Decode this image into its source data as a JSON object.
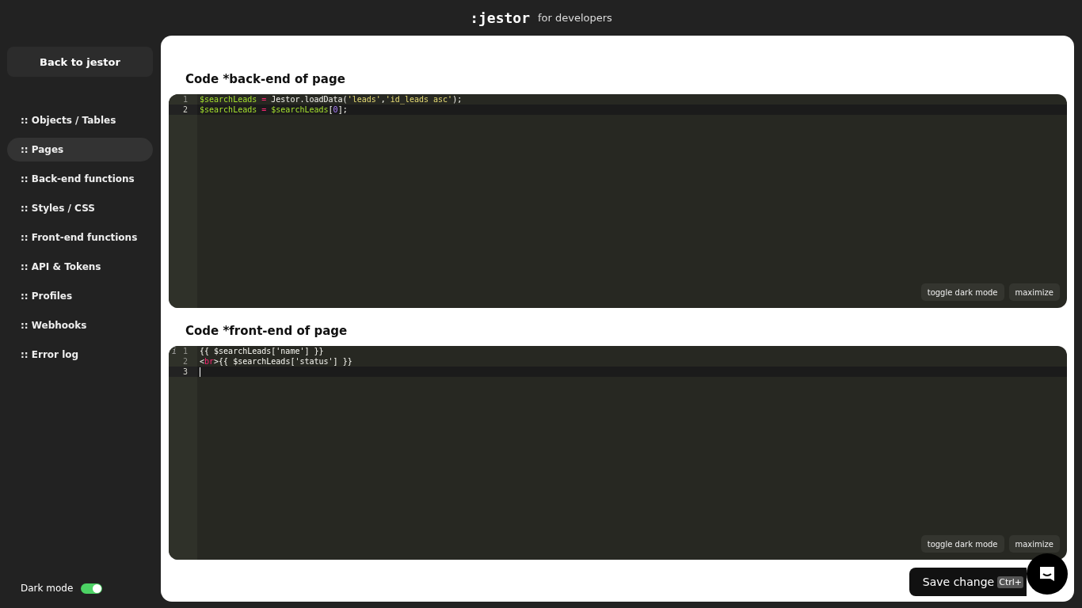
{
  "header": {
    "logo": ":jestor",
    "subtitle": "for developers"
  },
  "sidebar": {
    "back_button": "Back to jestor",
    "items": [
      {
        "label": ":: Objects / Tables",
        "selected": false
      },
      {
        "label": ":: Pages",
        "selected": true
      },
      {
        "label": ":: Back-end functions",
        "selected": false
      },
      {
        "label": ":: Styles / CSS",
        "selected": false
      },
      {
        "label": ":: Front-end functions",
        "selected": false
      },
      {
        "label": ":: API & Tokens",
        "selected": false
      },
      {
        "label": ":: Profiles",
        "selected": false
      },
      {
        "label": ":: Webhooks",
        "selected": false
      },
      {
        "label": ":: Error log",
        "selected": false
      }
    ],
    "dark_mode": {
      "label": "Dark mode",
      "on": true
    }
  },
  "editors": [
    {
      "title": "Code *back-end of page",
      "lines": [
        {
          "number": "1",
          "active": false,
          "tokens": [
            {
              "kind": "var",
              "text": "$searchLeads"
            },
            {
              "kind": "op",
              "text": " = "
            },
            {
              "kind": "plain",
              "text": "Jestor.loadData("
            },
            {
              "kind": "str",
              "text": "'leads'"
            },
            {
              "kind": "plain",
              "text": ","
            },
            {
              "kind": "str",
              "text": "'id_leads asc'"
            },
            {
              "kind": "plain",
              "text": ");"
            }
          ]
        },
        {
          "number": "2",
          "active": true,
          "tokens": [
            {
              "kind": "var",
              "text": "$searchLeads"
            },
            {
              "kind": "op",
              "text": " = "
            },
            {
              "kind": "var",
              "text": "$searchLeads"
            },
            {
              "kind": "plain",
              "text": "["
            },
            {
              "kind": "num",
              "text": "0"
            },
            {
              "kind": "plain",
              "text": "];"
            }
          ]
        }
      ],
      "buttons": [
        "toggle dark mode",
        "maximize"
      ]
    },
    {
      "title": "Code *front-end of page",
      "lines": [
        {
          "number": "1",
          "active": false,
          "marker": "i",
          "tokens": [
            {
              "kind": "plain",
              "text": "{{ $searchLeads['name'] }}"
            }
          ]
        },
        {
          "number": "2",
          "active": false,
          "tokens": [
            {
              "kind": "plain",
              "text": "<"
            },
            {
              "kind": "tag",
              "text": "br"
            },
            {
              "kind": "plain",
              "text": ">{{ $searchLeads['status'] }}"
            }
          ]
        },
        {
          "number": "3",
          "active": true
        }
      ],
      "buttons": [
        "toggle dark mode",
        "maximize"
      ]
    }
  ],
  "save_button": {
    "label": "Save change",
    "shortcut": "Ctrl+"
  }
}
